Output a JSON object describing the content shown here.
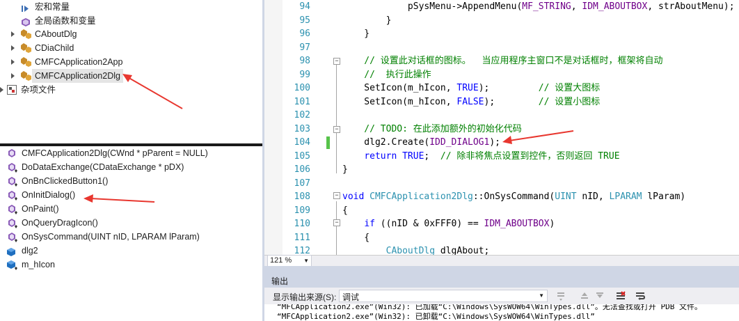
{
  "class_view": {
    "items": [
      {
        "label": "宏和常量",
        "icon": "macro-icon",
        "expandable": false
      },
      {
        "label": "全局函数和变量",
        "icon": "global-icon",
        "expandable": false
      },
      {
        "label": "CAboutDlg",
        "icon": "class-icon",
        "expandable": true
      },
      {
        "label": "CDiaChild",
        "icon": "class-icon",
        "expandable": true
      },
      {
        "label": "CMFCApplication2App",
        "icon": "class-icon",
        "expandable": true
      },
      {
        "label": "CMFCApplication2Dlg",
        "icon": "class-icon",
        "expandable": true,
        "selected": true
      },
      {
        "label": "杂项文件",
        "icon": "misc-files-icon",
        "expandable": true
      }
    ]
  },
  "members": {
    "items": [
      {
        "label": "CMFCApplication2Dlg(CWnd * pParent = NULL)",
        "icon": "method-icon"
      },
      {
        "label": "DoDataExchange(CDataExchange * pDX)",
        "icon": "protected-method-icon"
      },
      {
        "label": "OnBnClickedButton1()",
        "icon": "protected-method-icon"
      },
      {
        "label": "OnInitDialog()",
        "icon": "protected-method-icon"
      },
      {
        "label": "OnPaint()",
        "icon": "protected-method-icon"
      },
      {
        "label": "OnQueryDragIcon()",
        "icon": "protected-method-icon"
      },
      {
        "label": "OnSysCommand(UINT nID, LPARAM lParam)",
        "icon": "protected-method-icon"
      },
      {
        "label": "dlg2",
        "icon": "field-icon"
      },
      {
        "label": "m_hIcon",
        "icon": "protected-field-icon"
      }
    ]
  },
  "editor": {
    "lines": [
      {
        "n": "94",
        "text": "            pSysMenu->AppendMenu(MF_STRING, IDM_ABOUTBOX, strAboutMenu);"
      },
      {
        "n": "95",
        "text": "        }"
      },
      {
        "n": "96",
        "text": "    }"
      },
      {
        "n": "97",
        "text": ""
      },
      {
        "n": "98",
        "text": "    // 设置此对话框的图标。  当应用程序主窗口不是对话框时，框架将自动"
      },
      {
        "n": "99",
        "text": "    //  执行此操作"
      },
      {
        "n": "100",
        "text": "    SetIcon(m_hIcon, TRUE);         // 设置大图标"
      },
      {
        "n": "101",
        "text": "    SetIcon(m_hIcon, FALSE);        // 设置小图标"
      },
      {
        "n": "102",
        "text": ""
      },
      {
        "n": "103",
        "text": "    // TODO: 在此添加额外的初始化代码"
      },
      {
        "n": "104",
        "text": "    dlg2.Create(IDD_DIALOG1);"
      },
      {
        "n": "105",
        "text": "    return TRUE;  // 除非将焦点设置到控件，否则返回 TRUE"
      },
      {
        "n": "106",
        "text": "}"
      },
      {
        "n": "107",
        "text": ""
      },
      {
        "n": "108",
        "text": "void CMFCApplication2Dlg::OnSysCommand(UINT nID, LPARAM lParam)"
      },
      {
        "n": "109",
        "text": "{"
      },
      {
        "n": "110",
        "text": "    if ((nID & 0xFFF0) == IDM_ABOUTBOX)"
      },
      {
        "n": "111",
        "text": "    {"
      },
      {
        "n": "112",
        "text": "        CAboutDlg dlgAbout;"
      }
    ],
    "zoom": "121 %"
  },
  "output": {
    "title": "输出",
    "source_label": "显示输出来源(S):",
    "source_value": "调试",
    "lines": [
      "“MFCApplication2.exe”(Win32): 已加载“C:\\Windows\\SysWOW64\\WinTypes.dll”。无法查找或打开 PDB 文件。",
      "“MFCApplication2.exe”(Win32): 已卸载“C:\\Windows\\SysWOW64\\WinTypes.dll”"
    ]
  },
  "colors": {
    "accent_arrow": "#e8372f",
    "panel_bg": "#cfd6e5",
    "line_number": "#2b91af",
    "comment": "#008000",
    "keyword": "#0000ff"
  }
}
